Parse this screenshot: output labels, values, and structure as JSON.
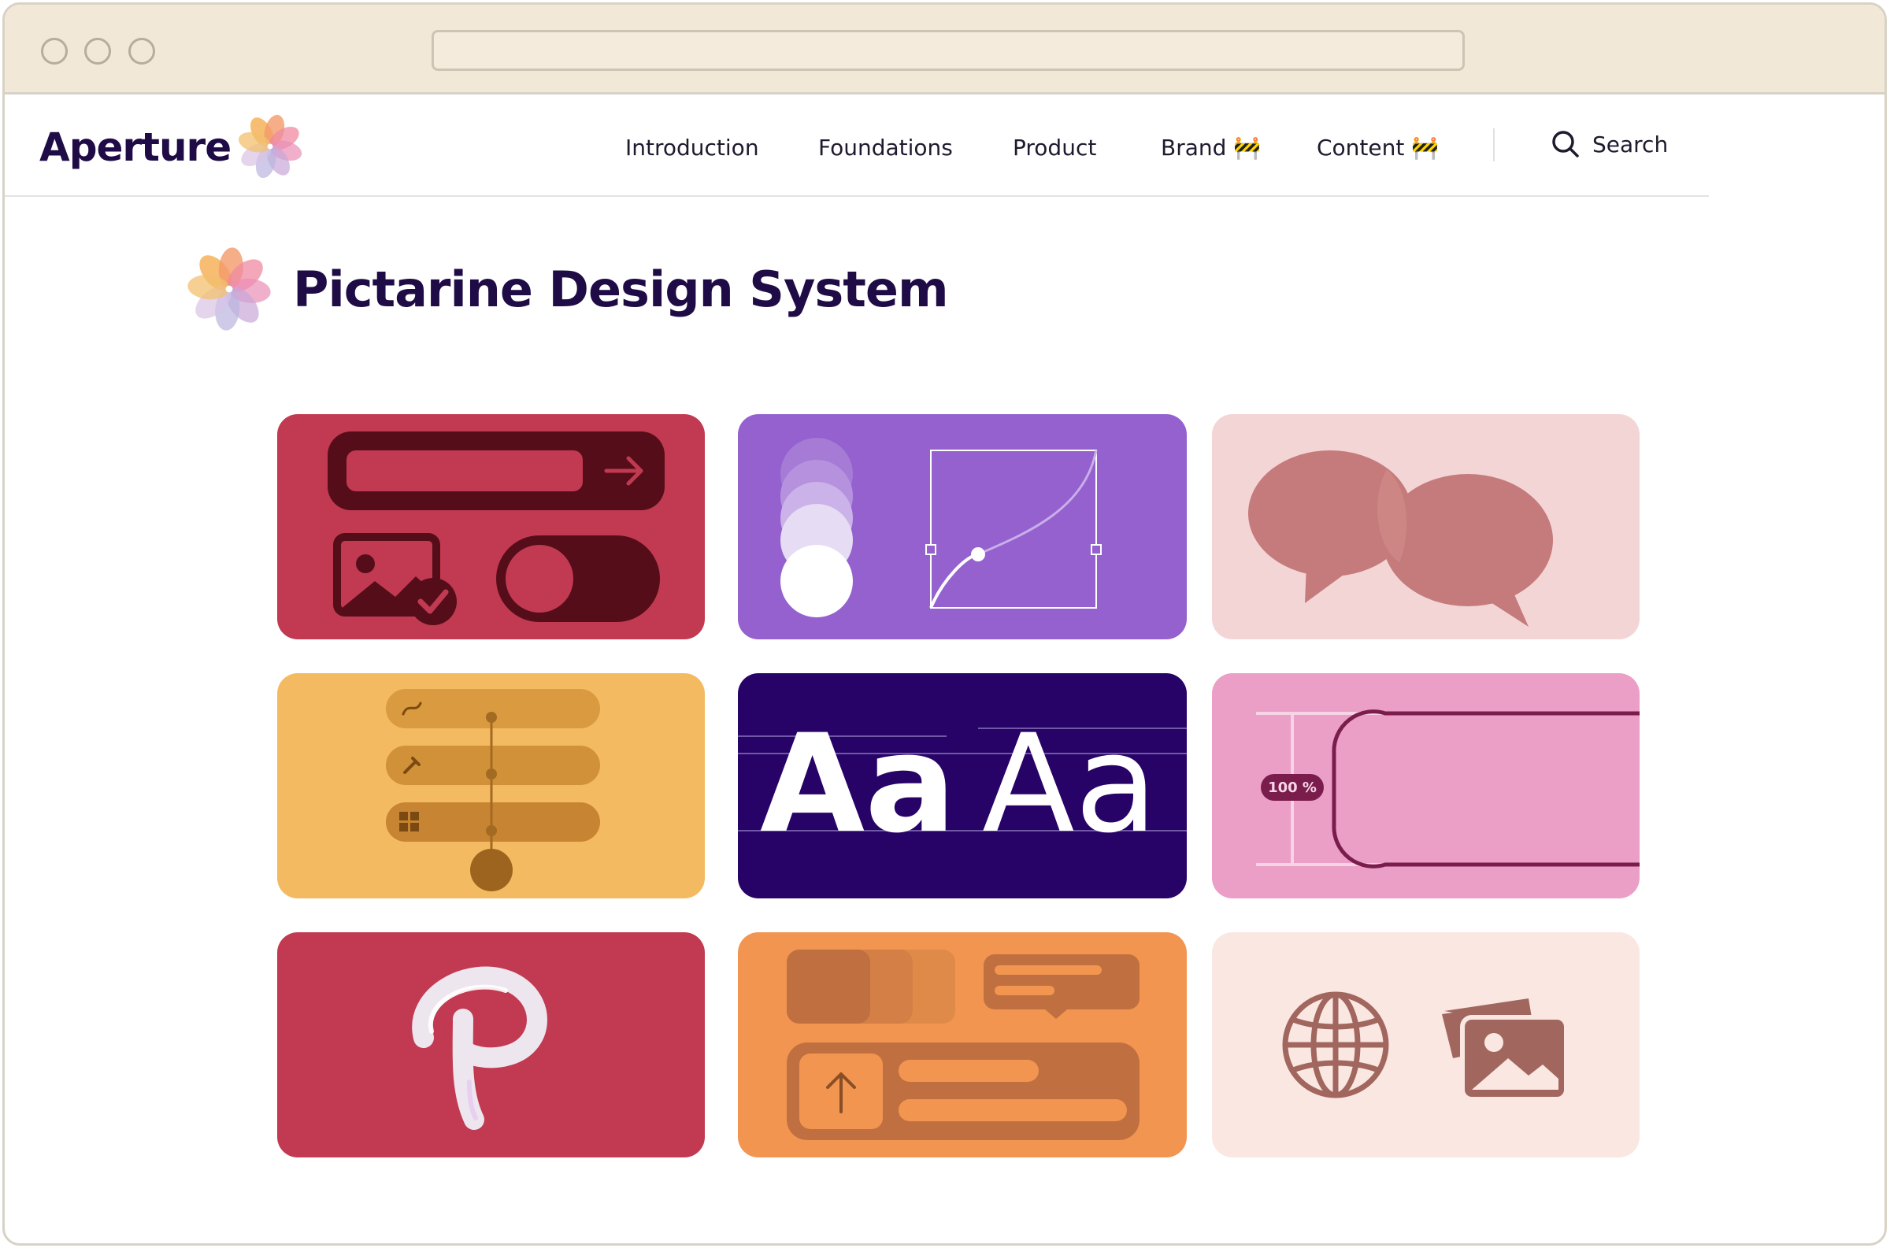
{
  "window": {
    "title_bar_color": "#f2e8d7",
    "url": ""
  },
  "brand": {
    "name": "Aperture",
    "logo_icon": "aperture-flower-logo"
  },
  "nav": {
    "items": [
      {
        "label": "Introduction"
      },
      {
        "label": "Foundations"
      },
      {
        "label": "Product"
      },
      {
        "label": "Brand 🚧"
      },
      {
        "label": "Content 🚧"
      }
    ],
    "search_label": "Search"
  },
  "page": {
    "title": "Pictarine Design System"
  },
  "cards": [
    {
      "name": "components",
      "color": "#c13a51",
      "icon": "components-illustration"
    },
    {
      "name": "motion",
      "color": "#9461ce",
      "icon": "easing-curve-illustration"
    },
    {
      "name": "voice-and-tone",
      "color": "#f3d5d6",
      "icon": "speech-bubbles-icon"
    },
    {
      "name": "patterns",
      "color": "#f3ba62",
      "icon": "workflow-steps-illustration"
    },
    {
      "name": "typography",
      "color": "#280367",
      "icon": "typography-illustration",
      "sample_text": "Aa",
      "sample_text_alt": "Aa"
    },
    {
      "name": "layout",
      "color": "#eb9fc7",
      "icon": "layout-spacing-illustration",
      "badge": "100 %"
    },
    {
      "name": "logo",
      "color": "#c13a51",
      "icon": "p-logo-illustration"
    },
    {
      "name": "ui-elements",
      "color": "#f19551",
      "icon": "upload-ui-illustration"
    },
    {
      "name": "illustrations",
      "color": "#fbe7e1",
      "icon": "globe-and-images-icon"
    }
  ]
}
